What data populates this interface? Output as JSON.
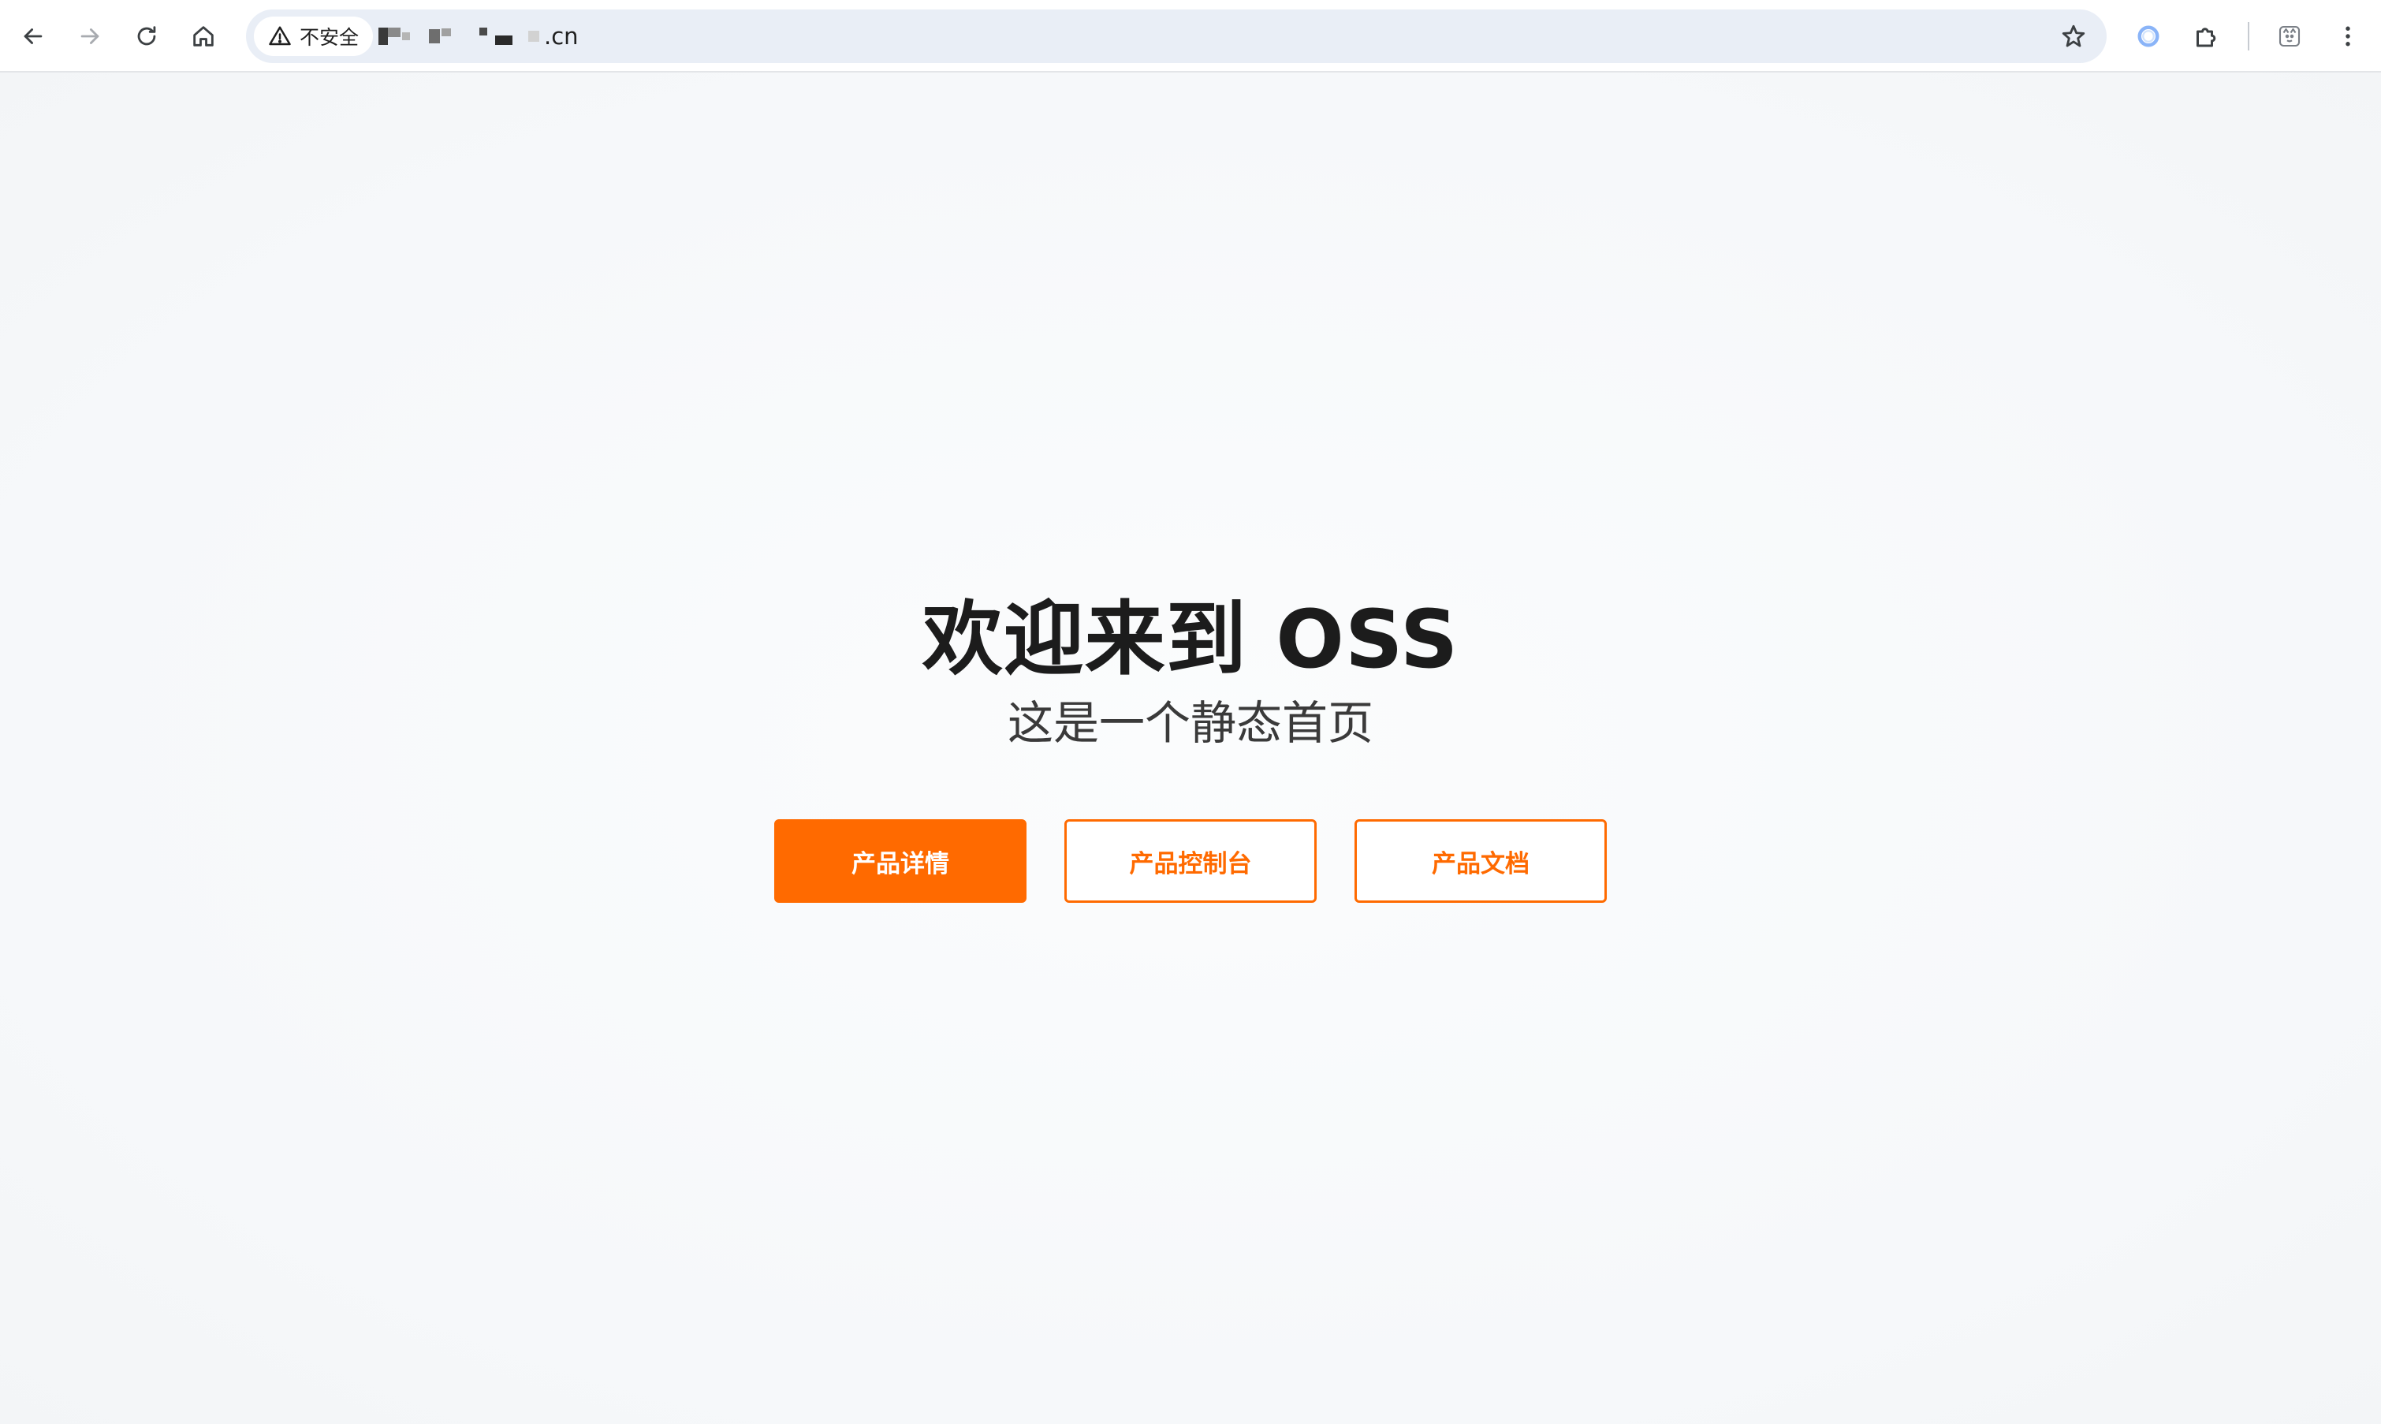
{
  "browser": {
    "security_label": "不安全",
    "url_suffix": ".cn",
    "icons": {
      "back": "back-arrow-icon",
      "forward": "forward-arrow-icon",
      "reload": "reload-icon",
      "home": "home-icon",
      "warning": "warning-triangle-icon",
      "bookmark": "bookmark-star-icon",
      "extension_ring": "extension-ring-icon",
      "extensions": "puzzle-piece-icon",
      "profile": "profile-avatar-icon",
      "menu": "kebab-menu-icon"
    }
  },
  "hero": {
    "title": "欢迎来到 OSS",
    "subtitle": "这是一个静态首页"
  },
  "buttons": {
    "product_details": "产品详情",
    "product_console": "产品控制台",
    "product_docs": "产品文档"
  },
  "colors": {
    "accent": "#ff6a00",
    "page_background": "#f6f8fa",
    "omnibox_background": "#e9eef6"
  }
}
